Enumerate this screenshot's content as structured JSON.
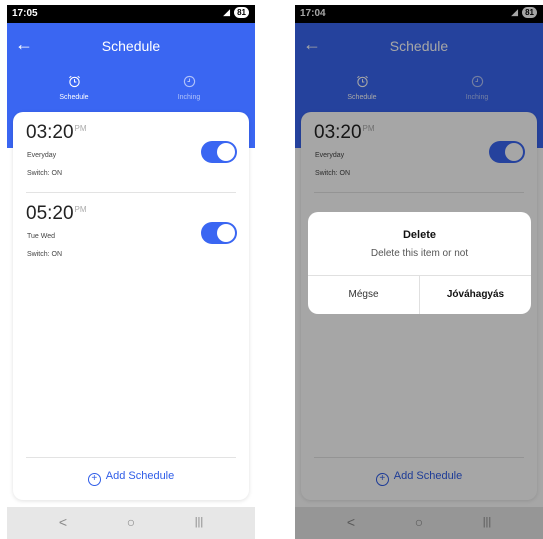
{
  "colors": {
    "accent": "#3a66f2",
    "link": "#2f5de8",
    "overlay": "rgba(0,0,0,0.35)"
  },
  "screens": [
    {
      "status": {
        "time": "17:05",
        "battery": "81"
      },
      "header": {
        "title": "Schedule"
      },
      "tabs": [
        {
          "label": "Schedule",
          "icon": "alarm-clock-icon",
          "active": true
        },
        {
          "label": "Inching",
          "icon": "clock-icon",
          "active": false
        }
      ],
      "schedules": [
        {
          "time": "03:20",
          "ampm": "PM",
          "days": "Everyday",
          "switch": "Switch: ON",
          "enabled": true
        },
        {
          "time": "05:20",
          "ampm": "PM",
          "days": "Tue Wed",
          "switch": "Switch: ON",
          "enabled": true
        }
      ],
      "add_label": "Add Schedule",
      "nav": {
        "back": "<",
        "home": "○",
        "recents": "|||"
      }
    },
    {
      "status": {
        "time": "17:04",
        "battery": "81"
      },
      "header": {
        "title": "Schedule"
      },
      "tabs": [
        {
          "label": "Schedule",
          "icon": "alarm-clock-icon",
          "active": true
        },
        {
          "label": "Inching",
          "icon": "clock-icon",
          "active": false
        }
      ],
      "schedules": [
        {
          "time": "03:20",
          "ampm": "PM",
          "days": "Everyday",
          "switch": "Switch: ON",
          "enabled": true
        }
      ],
      "add_label": "Add Schedule",
      "dialog": {
        "title": "Delete",
        "message": "Delete this item or not",
        "cancel": "Mégse",
        "confirm": "Jóváhagyás"
      },
      "nav": {
        "back": "<",
        "home": "○",
        "recents": "|||"
      }
    }
  ]
}
